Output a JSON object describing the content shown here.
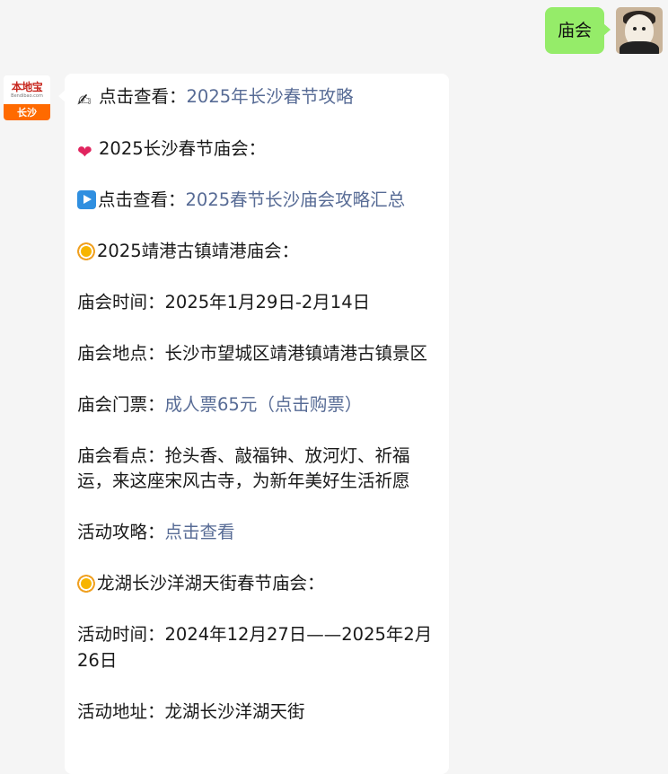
{
  "outgoing": {
    "text": "庙会"
  },
  "bot": {
    "brand_name": "本地宝",
    "brand_url": "Bendibao.com",
    "city": "长沙"
  },
  "message": {
    "p1": {
      "prefix": "点击查看：",
      "link": "2025年长沙春节攻略"
    },
    "p2": {
      "text": "2025长沙春节庙会："
    },
    "p3": {
      "prefix": "点击查看：",
      "link": "2025春节长沙庙会攻略汇总"
    },
    "p4": {
      "text": "2025靖港古镇靖港庙会："
    },
    "p5": {
      "label": "庙会时间：",
      "value": "2025年1月29日-2月14日"
    },
    "p6": {
      "label": "庙会地点：",
      "value": "长沙市望城区靖港镇靖港古镇景区"
    },
    "p7": {
      "label": "庙会门票：",
      "link": "成人票65元（点击购票）"
    },
    "p8": {
      "label": "庙会看点：",
      "value": "抢头香、敲福钟、放河灯、祈福运，来这座宋风古寺，为新年美好生活祈愿"
    },
    "p9": {
      "label": "活动攻略：",
      "link": "点击查看"
    },
    "p10": {
      "text": "龙湖长沙洋湖天街春节庙会："
    },
    "p11": {
      "label": "活动时间：",
      "value": "2024年12月27日——2025年2月26日"
    },
    "p12": {
      "label": "活动地址：",
      "value": "龙湖长沙洋湖天街"
    }
  },
  "icons": {
    "writing": "writing-hand-icon",
    "heart": "heart-icon",
    "play": "play-button-icon",
    "sun": "sun-icon"
  },
  "colors": {
    "outgoing_bubble": "#95ec69",
    "link": "#576b95",
    "background": "#f5f5f5"
  }
}
